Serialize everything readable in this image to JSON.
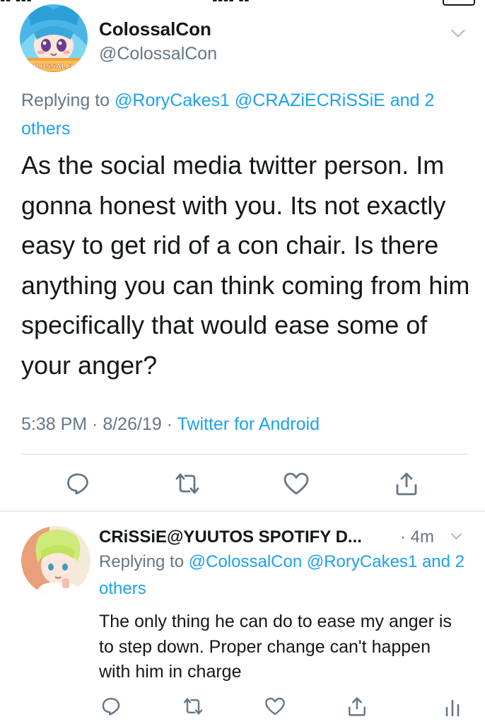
{
  "main_tweet": {
    "author_name": "ColossalCon",
    "author_handle": "@ColossalCon",
    "avatar_badge_text": "COLOSSALCON",
    "replying_prefix": "Replying to ",
    "replying_links": [
      "@RoryCakes1",
      "@CRAZiECRiSSiE",
      "and 2 others"
    ],
    "text": "As the social media twitter person. Im gonna honest with you. Its not exactly easy to get rid of a con chair. Is there anything you can think coming from him specifically that would ease some of your anger?",
    "time": "5:38 PM",
    "separator": " · ",
    "date": "8/26/19",
    "source": "Twitter for Android",
    "actions": [
      "reply-icon",
      "retweet-icon",
      "like-icon",
      "share-icon"
    ]
  },
  "reply_tweet": {
    "author_name": "CRiSSiE@YUUTOS SPOTIFY D...",
    "time": "· 4m",
    "replying_prefix": "Replying to ",
    "replying_links": [
      "@ColossalCon",
      "@RoryCakes1",
      "and 2 others"
    ],
    "text": "The only thing he can do to ease my anger is to step down. Proper change can't happen with him in charge",
    "actions": [
      "reply-icon",
      "retweet-icon",
      "like-icon",
      "share-icon",
      "analytics-icon"
    ]
  },
  "colors": {
    "accent": "#1da1f2",
    "secondary_text": "#657786",
    "primary_text": "#14171a",
    "icon": "#657786",
    "divider": "#d6dde3"
  }
}
